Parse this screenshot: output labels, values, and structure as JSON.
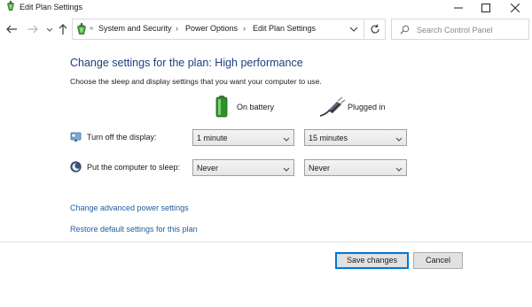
{
  "window": {
    "title": "Edit Plan Settings",
    "controls": [
      "minimize-icon",
      "maximize-icon",
      "close-icon"
    ]
  },
  "navigation": {
    "back_icon": "arrow-left-icon",
    "forward_icon": "arrow-right-icon",
    "recent_icon": "chevron-down-icon",
    "up_icon": "arrow-up-icon"
  },
  "address_bar": {
    "icon": "control-panel-icon",
    "overflow": "«",
    "breadcrumbs": [
      "System and Security",
      "Power Options",
      "Edit Plan Settings"
    ],
    "separator": "›",
    "dropdown_icon": "chevron-down-icon",
    "refresh_icon": "refresh-icon"
  },
  "search": {
    "placeholder": "Search Control Panel",
    "value": "",
    "icon": "search-icon"
  },
  "main": {
    "heading": "Change settings for the plan: High performance",
    "subtext": "Choose the sleep and display settings that you want your computer to use.",
    "columns": {
      "battery": {
        "label": "On battery",
        "icon": "battery-icon"
      },
      "plugged": {
        "label": "Plugged in",
        "icon": "power-plug-icon"
      }
    },
    "display_row": {
      "label": "Turn off the display:",
      "icon": "display-timer-icon",
      "battery_value": "1 minute",
      "plugged_value": "15 minutes"
    },
    "sleep_row": {
      "label": "Put the computer to sleep:",
      "icon": "sleep-moon-icon",
      "battery_value": "Never",
      "plugged_value": "Never"
    },
    "links": {
      "advanced": "Change advanced power settings",
      "restore": "Restore default settings for this plan"
    }
  },
  "footer": {
    "save_label": "Save changes",
    "cancel_label": "Cancel"
  },
  "colors": {
    "heading": "#1e3f80",
    "link": "#1f5d9e",
    "default_button_border": "#0078d7"
  }
}
